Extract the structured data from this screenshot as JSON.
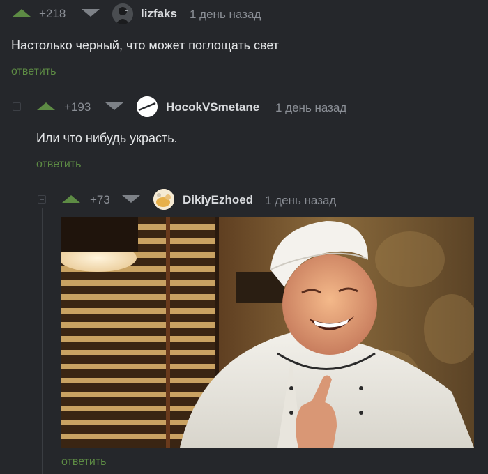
{
  "comments": [
    {
      "rating": "+218",
      "author": "lizfaks",
      "time": "1 день назад",
      "text": "Настолько черный, что может поглощать свет",
      "reply_label": "ответить"
    },
    {
      "rating": "+193",
      "author": "HocokVSmetane",
      "time": "1 день назад",
      "text": "Или что нибудь украсть.",
      "reply_label": "ответить"
    },
    {
      "rating": "+73",
      "author": "DikiyEzhoed",
      "time": "1 день назад",
      "reply_label": "ответить"
    }
  ],
  "colors": {
    "background": "#25272b",
    "upvote": "#5d8b44",
    "reply_link": "#5d8b44",
    "downvote": "#7d8187"
  },
  "icons": [
    "upvote-icon",
    "downvote-icon",
    "collapse-icon",
    "avatar"
  ]
}
